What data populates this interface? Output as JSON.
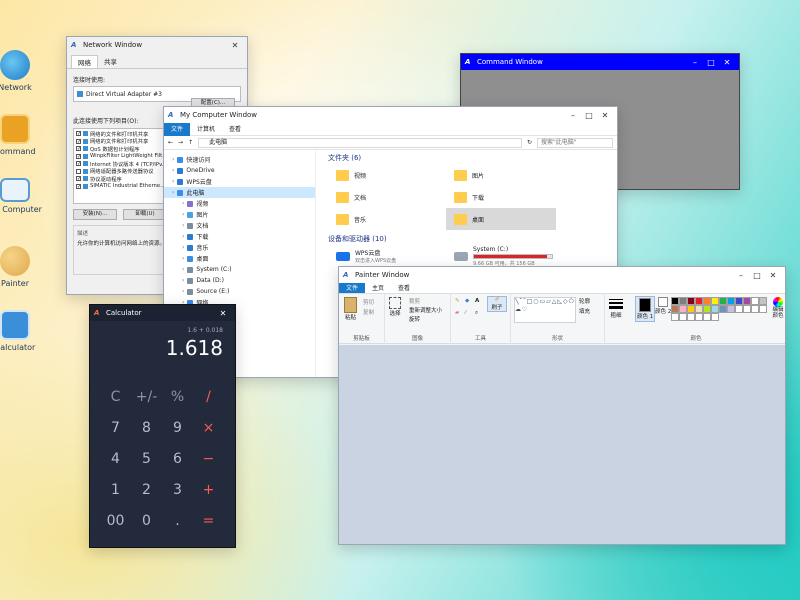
{
  "desktop": {
    "icons": [
      {
        "label": "Network",
        "icon": "globe-icon"
      },
      {
        "label": "Command",
        "icon": "terminal-icon"
      },
      {
        "label": "My Computer",
        "icon": "computer-icon"
      },
      {
        "label": "Painter",
        "icon": "palette-icon"
      },
      {
        "label": "Calculator",
        "icon": "calculator-icon"
      }
    ]
  },
  "network_window": {
    "title": "Network Window",
    "tabs": [
      "网络",
      "共享"
    ],
    "connect_using_label": "连接时使用:",
    "adapter": "Direct Virtual Adapter #3",
    "configure_button": "配置(C)...",
    "items_label": "此连接使用下列项目(O):",
    "items": [
      {
        "checked": true,
        "text": "网络的文件和打印机共享"
      },
      {
        "checked": true,
        "text": "网络的文件和打印机共享"
      },
      {
        "checked": true,
        "text": "QoS 数据包计划程序"
      },
      {
        "checked": true,
        "text": "WinpkFilter LightWeight Filt..."
      },
      {
        "checked": true,
        "text": "Internet 协议版本 4 (TCP/IPv..."
      },
      {
        "checked": false,
        "text": "网络适配器多路传送器协议"
      },
      {
        "checked": true,
        "text": "协议驱动程序"
      },
      {
        "checked": true,
        "text": "SIMATIC Industrial Etherne..."
      }
    ],
    "install_button": "安装(N)...",
    "uninstall_button": "卸载(U)",
    "description_label": "描述",
    "description_text": "允许你的计算机访问网络上的资源。"
  },
  "command_window": {
    "title": "Command Window"
  },
  "my_computer_window": {
    "title": "My Computer Window",
    "ribbon_tabs": [
      "文件",
      "计算机",
      "查看"
    ],
    "address": "此电脑",
    "search_placeholder": "搜索\"此电脑\"",
    "nav_items": [
      {
        "label": "快速访问",
        "sub": false,
        "selected": false,
        "color": "#3a8ee6"
      },
      {
        "label": "OneDrive",
        "sub": false,
        "selected": false,
        "color": "#2a7bd4"
      },
      {
        "label": "WPS云盘",
        "sub": false,
        "selected": false,
        "color": "#2a7bd4"
      },
      {
        "label": "此电脑",
        "sub": false,
        "selected": true,
        "color": "#3a8ee6"
      },
      {
        "label": "视频",
        "sub": true,
        "selected": false,
        "color": "#8a6fd1"
      },
      {
        "label": "图片",
        "sub": true,
        "selected": false,
        "color": "#4aa3df"
      },
      {
        "label": "文档",
        "sub": true,
        "selected": false,
        "color": "#7b8da1"
      },
      {
        "label": "下载",
        "sub": true,
        "selected": false,
        "color": "#2a7bd4"
      },
      {
        "label": "音乐",
        "sub": true,
        "selected": false,
        "color": "#2a7bd4"
      },
      {
        "label": "桌面",
        "sub": true,
        "selected": false,
        "color": "#3a8ee6"
      },
      {
        "label": "System (C:)",
        "sub": true,
        "selected": false,
        "color": "#7b8da1"
      },
      {
        "label": "Data (D:)",
        "sub": true,
        "selected": false,
        "color": "#7b8da1"
      },
      {
        "label": "Source (E:)",
        "sub": true,
        "selected": false,
        "color": "#7b8da1"
      },
      {
        "label": "网络",
        "sub": true,
        "selected": false,
        "color": "#3a8ee6"
      }
    ],
    "folders_header": "文件夹 (6)",
    "folders": [
      {
        "label": "视频",
        "selected": false
      },
      {
        "label": "图片",
        "selected": false
      },
      {
        "label": "文档",
        "selected": false
      },
      {
        "label": "下载",
        "selected": false
      },
      {
        "label": "音乐",
        "selected": false
      },
      {
        "label": "桌面",
        "selected": true
      }
    ],
    "devices_header": "设备和驱动器 (10)",
    "devices": [
      {
        "label": "WPS云盘",
        "sub": "双击进入WPS云盘",
        "type": "cloud"
      },
      {
        "label": "System (C:)",
        "sub": "9.66 GB 可用，共 156 GB",
        "type": "drive",
        "usage": 0.94
      }
    ]
  },
  "painter_window": {
    "title": "Painter Window",
    "ribbon_tabs": [
      "文件",
      "主页",
      "查看"
    ],
    "groups": {
      "clipboard": "剪贴板",
      "image": "图像",
      "tools": "工具",
      "shapes": "形状",
      "colors": "颜色"
    },
    "paste_label": "粘贴",
    "cut_label": "剪切",
    "copy_label": "复制",
    "select_label": "选择",
    "crop_label": "裁剪",
    "resize_label": "重新调整大小",
    "rotate_label": "旋转",
    "brush_label": "刷子",
    "outline_label": "轮廓",
    "fill_label": "填充",
    "size_label": "粗细",
    "color1_label": "颜色 1",
    "color2_label": "颜色 2",
    "edit_colors_label": "编辑颜色",
    "palette": [
      "#000000",
      "#7f7f7f",
      "#880015",
      "#ed1c24",
      "#ff7f27",
      "#fff200",
      "#22b14c",
      "#00a2e8",
      "#3f48cc",
      "#a349a4",
      "#ffffff",
      "#c3c3c3",
      "#b97a57",
      "#ffaec9",
      "#ffc90e",
      "#efe4b0",
      "#b5e61d",
      "#99d9ea",
      "#7092be",
      "#c8bfe7"
    ]
  },
  "calculator_window": {
    "title": "Calculator",
    "expression": "1.6 + 0.018",
    "display": "1.618",
    "keys": [
      {
        "label": "C",
        "kind": "fn",
        "name": "clear-key"
      },
      {
        "label": "+/-",
        "kind": "fn",
        "name": "sign-key"
      },
      {
        "label": "%",
        "kind": "fn",
        "name": "percent-key"
      },
      {
        "label": "/",
        "kind": "op",
        "name": "divide-key"
      },
      {
        "label": "7",
        "kind": "num",
        "name": "key-7"
      },
      {
        "label": "8",
        "kind": "num",
        "name": "key-8"
      },
      {
        "label": "9",
        "kind": "num",
        "name": "key-9"
      },
      {
        "label": "×",
        "kind": "op",
        "name": "multiply-key"
      },
      {
        "label": "4",
        "kind": "num",
        "name": "key-4"
      },
      {
        "label": "5",
        "kind": "num",
        "name": "key-5"
      },
      {
        "label": "6",
        "kind": "num",
        "name": "key-6"
      },
      {
        "label": "−",
        "kind": "op",
        "name": "subtract-key"
      },
      {
        "label": "1",
        "kind": "num",
        "name": "key-1"
      },
      {
        "label": "2",
        "kind": "num",
        "name": "key-2"
      },
      {
        "label": "3",
        "kind": "num",
        "name": "key-3"
      },
      {
        "label": "+",
        "kind": "op",
        "name": "add-key"
      },
      {
        "label": "00",
        "kind": "num",
        "name": "key-00"
      },
      {
        "label": "0",
        "kind": "num",
        "name": "key-0"
      },
      {
        "label": ".",
        "kind": "num",
        "name": "decimal-key"
      },
      {
        "label": "=",
        "kind": "op",
        "name": "equals-key"
      }
    ]
  }
}
